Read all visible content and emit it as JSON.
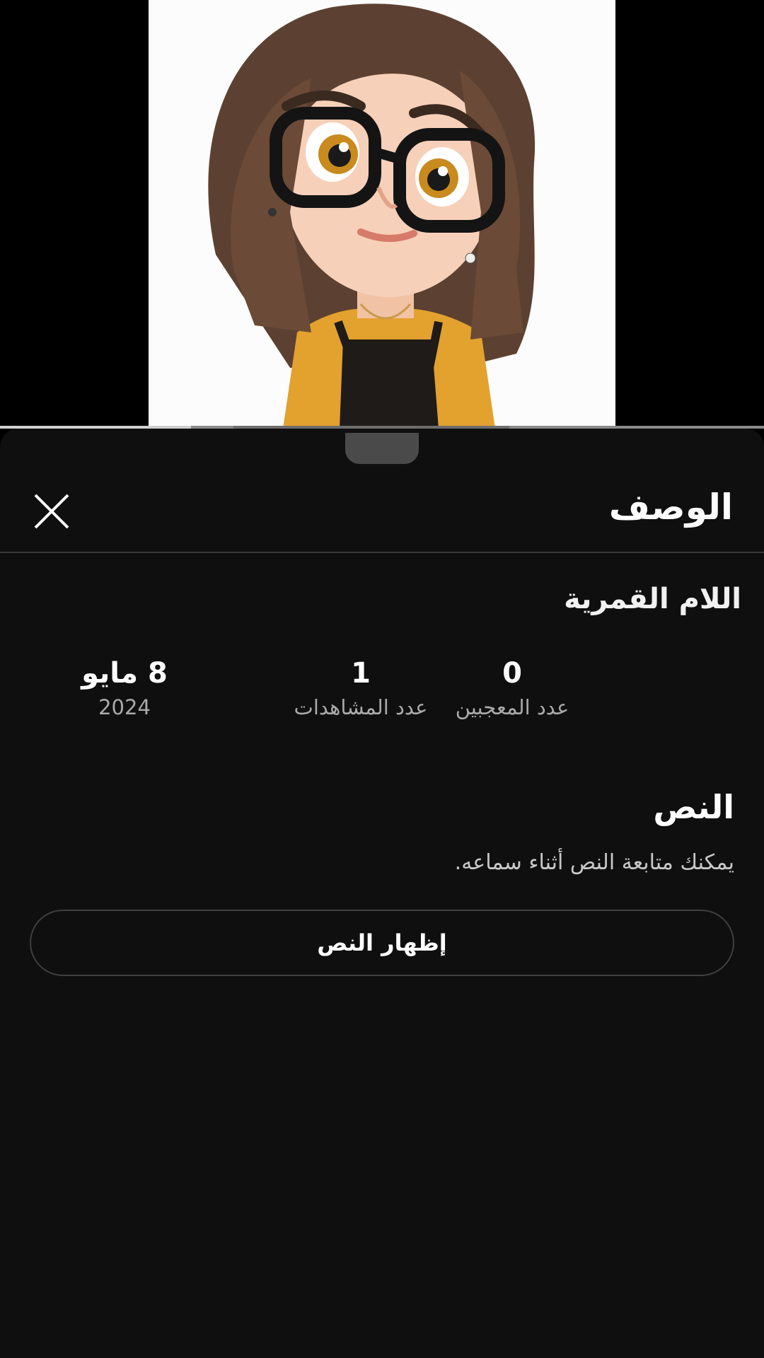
{
  "sheet": {
    "title": "الوصف",
    "close_icon": "close-icon"
  },
  "video": {
    "title": "اللام القمرية",
    "progress": 0.25
  },
  "stats": {
    "likes": {
      "value": "0",
      "label": "عدد المعجبين"
    },
    "views": {
      "value": "1",
      "label": "عدد المشاهدات"
    },
    "date": {
      "value": "8 مايو",
      "label": "2024"
    }
  },
  "transcript": {
    "title": "النص",
    "description": "يمكنك متابعة النص أثناء سماعه.",
    "button_label": "إظهار النص"
  },
  "colors": {
    "background": "#0f0f0f",
    "primary_text": "#ffffff",
    "secondary_text": "#aaaaaa",
    "divider": "#3a3a3a"
  }
}
